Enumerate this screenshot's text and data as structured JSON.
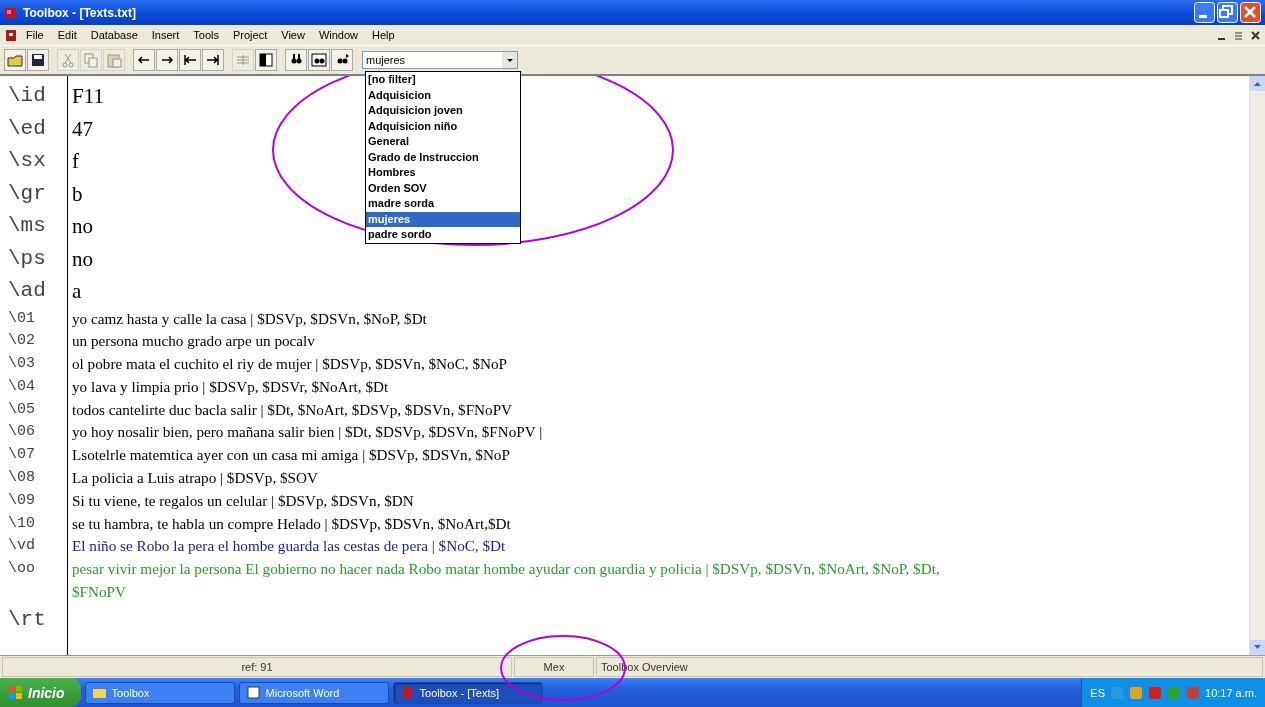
{
  "window": {
    "title": "Toolbox - [Texts.txt]"
  },
  "menu": [
    "File",
    "Edit",
    "Database",
    "Insert",
    "Tools",
    "Project",
    "View",
    "Window",
    "Help"
  ],
  "toolbar": {
    "buttons": [
      {
        "kind": "open",
        "disabled": false
      },
      {
        "kind": "save",
        "disabled": false
      },
      {
        "kind": "cut",
        "disabled": true
      },
      {
        "kind": "copy",
        "disabled": true
      },
      {
        "kind": "paste",
        "disabled": true
      },
      {
        "kind": "left",
        "disabled": false
      },
      {
        "kind": "right",
        "disabled": false
      },
      {
        "kind": "first",
        "disabled": false
      },
      {
        "kind": "last",
        "disabled": false
      },
      {
        "kind": "grid",
        "disabled": true
      },
      {
        "kind": "panel",
        "disabled": false
      },
      {
        "kind": "find",
        "disabled": false
      },
      {
        "kind": "findall",
        "disabled": false
      },
      {
        "kind": "findnext",
        "disabled": false
      }
    ],
    "filter": {
      "value": "mujeres",
      "expanded": true,
      "options": [
        {
          "label": "[no filter]",
          "selected": false
        },
        {
          "label": "Adquisicion",
          "selected": false
        },
        {
          "label": "Adquisicion joven",
          "selected": false
        },
        {
          "label": "Adquisicion niño",
          "selected": false
        },
        {
          "label": "General",
          "selected": false
        },
        {
          "label": "Grado de Instruccion",
          "selected": false
        },
        {
          "label": "Hombres",
          "selected": false
        },
        {
          "label": "Orden SOV",
          "selected": false
        },
        {
          "label": "madre sorda",
          "selected": false
        },
        {
          "label": "mujeres",
          "selected": true
        },
        {
          "label": "padre sordo",
          "selected": false
        }
      ]
    }
  },
  "record": {
    "fields": [
      {
        "marker": "\\id",
        "kind": "large",
        "color": "#000000",
        "value": "F11"
      },
      {
        "marker": "\\ed",
        "kind": "large",
        "color": "#000000",
        "value": "47"
      },
      {
        "marker": "\\sx",
        "kind": "large",
        "color": "#000000",
        "value": "f"
      },
      {
        "marker": "\\gr",
        "kind": "large",
        "color": "#000000",
        "value": "b"
      },
      {
        "marker": "\\ms",
        "kind": "large",
        "color": "#000000",
        "value": "no"
      },
      {
        "marker": "\\ps",
        "kind": "large",
        "color": "#000000",
        "value": "no"
      },
      {
        "marker": "\\ad",
        "kind": "large",
        "color": "#000000",
        "value": "a"
      },
      {
        "marker": "\\01",
        "kind": "small",
        "color": "#000000",
        "value": "yo camz hasta y calle la casa | $DSVp, $DSVn, $NoP, $Dt"
      },
      {
        "marker": "\\02",
        "kind": "small",
        "color": "#000000",
        "value": "un persona mucho grado arpe un pocalv"
      },
      {
        "marker": "\\03",
        "kind": "small",
        "color": "#000000",
        "value": "ol pobre mata el cuchito el riy de mujer | $DSVp, $DSVn, $NoC, $NoP"
      },
      {
        "marker": "\\04",
        "kind": "small",
        "color": "#000000",
        "value": "yo lava y limpia prio | $DSVp, $DSVr, $NoArt, $Dt"
      },
      {
        "marker": "\\05",
        "kind": "small",
        "color": "#000000",
        "value": "todos cantelirte duc bacla salir | $Dt, $NoArt, $DSVp, $DSVn, $FNoPV"
      },
      {
        "marker": "\\06",
        "kind": "small",
        "color": "#000000",
        "value": "yo hoy nosalir bien, pero mañana salir bien | $Dt, $DSVp, $DSVn, $FNoPV |"
      },
      {
        "marker": "\\07",
        "kind": "small",
        "color": "#000000",
        "value": "Lsotelrle matemtica ayer con un casa mi amiga | $DSVp, $DSVn, $NoP"
      },
      {
        "marker": "\\08",
        "kind": "small",
        "color": "#000000",
        "value": "La policia a Luis atrapo | $DSVp, $SOV"
      },
      {
        "marker": "\\09",
        "kind": "small",
        "color": "#000000",
        "value": "Si tu viene, te regalos un celular | $DSVp, $DSVn, $DN"
      },
      {
        "marker": "\\10",
        "kind": "small",
        "color": "#000000",
        "value": "se tu hambra, te habla un compre Helado | $DSVp, $DSVn, $NoArt,$Dt"
      },
      {
        "marker": "\\vd",
        "kind": "small",
        "color": "#1a1aa0",
        "value": "El niño se Robo la pera el hombe guarda las cestas de pera | $NoC, $Dt"
      },
      {
        "marker": "\\oo",
        "kind": "small",
        "color": "#2a9a2a",
        "value": "pesar vivir mejor la persona El gobierno no hacer nada Robo matar hombe ayudar con guardia y policia | $DSVp, $DSVn, $NoArt, $NoP, $Dt, $FNoPV"
      },
      {
        "marker": "\\rt",
        "kind": "large"
      }
    ]
  },
  "status_bar": [
    "ref: 91",
    "Mex",
    "Toolbox Overview"
  ],
  "taskbar": {
    "start": "Inicio",
    "tasks": [
      {
        "label": "Toolbox",
        "selected": false
      },
      {
        "label": "Microsoft Word",
        "selected": false
      },
      {
        "label": "Toolbox - [Texts]",
        "selected": true
      }
    ],
    "tray_language": "ES",
    "clock": "10:17 a.m."
  }
}
